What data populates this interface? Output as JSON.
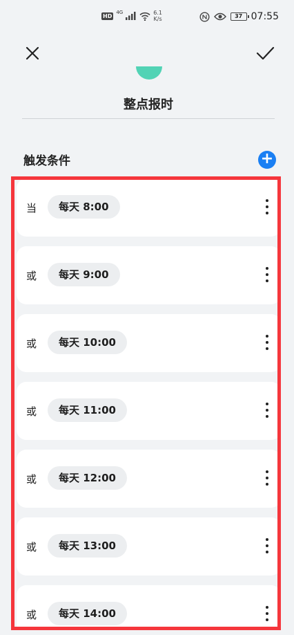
{
  "status_bar": {
    "network_badge": "HD",
    "network_type": "4G",
    "speed_value": "6.1",
    "speed_unit": "K/s",
    "battery": "37",
    "time": "07:55"
  },
  "header": {
    "title": "整点报时"
  },
  "triggers": {
    "section_title": "触发条件",
    "items": [
      {
        "prefix": "当",
        "time": "每天 8:00"
      },
      {
        "prefix": "或",
        "time": "每天 9:00"
      },
      {
        "prefix": "或",
        "time": "每天 10:00"
      },
      {
        "prefix": "或",
        "time": "每天 11:00"
      },
      {
        "prefix": "或",
        "time": "每天 12:00"
      },
      {
        "prefix": "或",
        "time": "每天 13:00"
      },
      {
        "prefix": "或",
        "time": "每天 14:00"
      }
    ]
  },
  "colors": {
    "accent": "#1a7ff3",
    "highlight_border": "#f5363c",
    "icon_teal": "#52d3b5",
    "background": "#f1f3f5"
  }
}
